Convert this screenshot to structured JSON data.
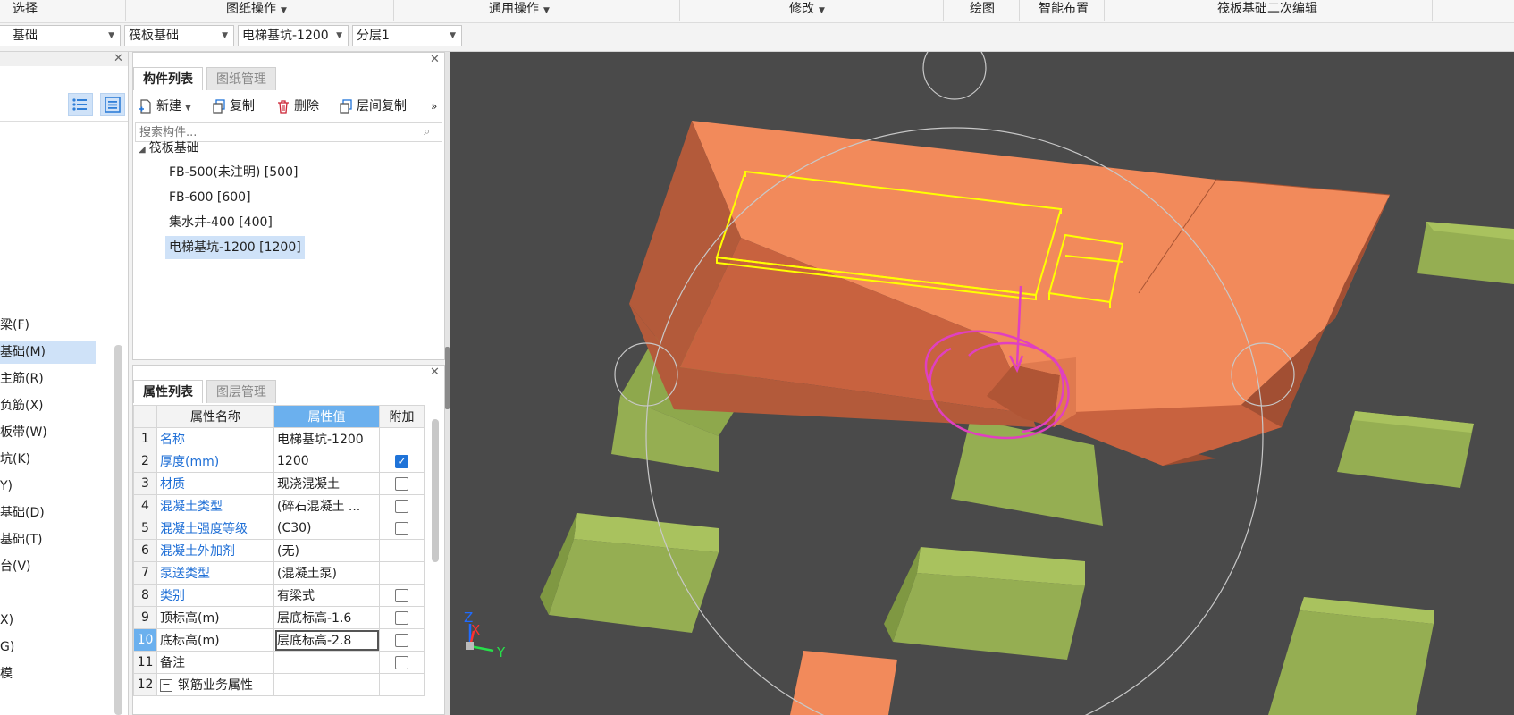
{
  "ribbon": {
    "groups": [
      {
        "label": "选择",
        "has_dropdown": false
      },
      {
        "label": "图纸操作",
        "has_dropdown": true
      },
      {
        "label": "通用操作",
        "has_dropdown": true
      },
      {
        "label": "修改",
        "has_dropdown": true
      },
      {
        "label": "绘图",
        "has_dropdown": false
      },
      {
        "label": "智能布置",
        "has_dropdown": false
      },
      {
        "label": "筏板基础二次编辑",
        "has_dropdown": false
      }
    ]
  },
  "selectors": {
    "category": "基础",
    "type": "筏板基础",
    "component": "电梯基坑-1200",
    "layer": "分层1"
  },
  "nav": {
    "items": [
      "梁(F)",
      "基础(M)",
      "主筋(R)",
      "负筋(X)",
      "板带(W)",
      "坑(K)",
      "Y)",
      "基础(D)",
      "基础(T)",
      "台(V)",
      "X)",
      "G)",
      "模"
    ],
    "selected_index": 1
  },
  "component_panel": {
    "tabs": [
      "构件列表",
      "图纸管理"
    ],
    "active_tab": 0,
    "toolbar": {
      "new": "新建",
      "copy": "复制",
      "delete": "删除",
      "floor_copy": "层间复制",
      "more": "»"
    },
    "search_placeholder": "搜索构件...",
    "tree": {
      "group": "筏板基础",
      "items": [
        "FB-500(未注明) [500]",
        "FB-600 [600]",
        "集水井-400 [400]",
        "电梯基坑-1200 [1200]"
      ],
      "selected_index": 3
    }
  },
  "property_panel": {
    "tabs": [
      "属性列表",
      "图层管理"
    ],
    "active_tab": 0,
    "headers": {
      "name": "属性名称",
      "value": "属性值",
      "extra": "附加"
    },
    "rows": [
      {
        "num": "1",
        "name": "名称",
        "value": "电梯基坑-1200",
        "blue": true,
        "check": "none"
      },
      {
        "num": "2",
        "name": "厚度(mm)",
        "value": "1200",
        "blue": true,
        "check": "on"
      },
      {
        "num": "3",
        "name": "材质",
        "value": "现浇混凝土",
        "blue": true,
        "check": "off"
      },
      {
        "num": "4",
        "name": "混凝土类型",
        "value": "(碎石混凝土 ...",
        "blue": true,
        "check": "off"
      },
      {
        "num": "5",
        "name": "混凝土强度等级",
        "value": "(C30)",
        "blue": true,
        "check": "off"
      },
      {
        "num": "6",
        "name": "混凝土外加剂",
        "value": "(无)",
        "blue": true,
        "check": "none"
      },
      {
        "num": "7",
        "name": "泵送类型",
        "value": "(混凝土泵)",
        "blue": true,
        "check": "none"
      },
      {
        "num": "8",
        "name": "类别",
        "value": "有梁式",
        "blue": true,
        "check": "off"
      },
      {
        "num": "9",
        "name": "顶标高(m)",
        "value": "层底标高-1.6",
        "blue": false,
        "check": "off"
      },
      {
        "num": "10",
        "name": "底标高(m)",
        "value": "层底标高-2.8",
        "blue": false,
        "check": "off"
      },
      {
        "num": "11",
        "name": "备注",
        "value": "",
        "blue": false,
        "check": "off"
      },
      {
        "num": "12",
        "name": "钢筋业务属性",
        "value": "",
        "blue": false,
        "check": "none"
      }
    ],
    "highlight_row": 9
  },
  "viewport": {
    "axis_labels": {
      "z": "Z",
      "x": "X",
      "y": "Y"
    },
    "colors": {
      "background": "#4a4a4a",
      "pit": "#f28a5b",
      "footing": "#9fb65a",
      "selection": "#ffff00",
      "annotation": "#e040c0"
    }
  }
}
